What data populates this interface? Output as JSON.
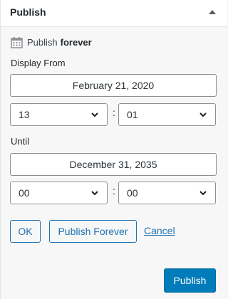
{
  "panel": {
    "title": "Publish"
  },
  "publish_status": {
    "prefix": "Publish",
    "value": "forever"
  },
  "display_from": {
    "label": "Display From",
    "date": "February 21, 2020",
    "hour": "13",
    "minute": "01"
  },
  "until": {
    "label": "Until",
    "date": "December 31, 2035",
    "hour": "00",
    "minute": "00"
  },
  "time_separator": ":",
  "actions": {
    "ok": "OK",
    "publish_forever": "Publish Forever",
    "cancel": "Cancel",
    "publish": "Publish"
  },
  "colors": {
    "accent": "#2271b1",
    "primary_button": "#007cba"
  },
  "icons": {
    "status": "calendar-icon",
    "collapse": "caret-up-icon",
    "select": "chevron-down-icon"
  }
}
